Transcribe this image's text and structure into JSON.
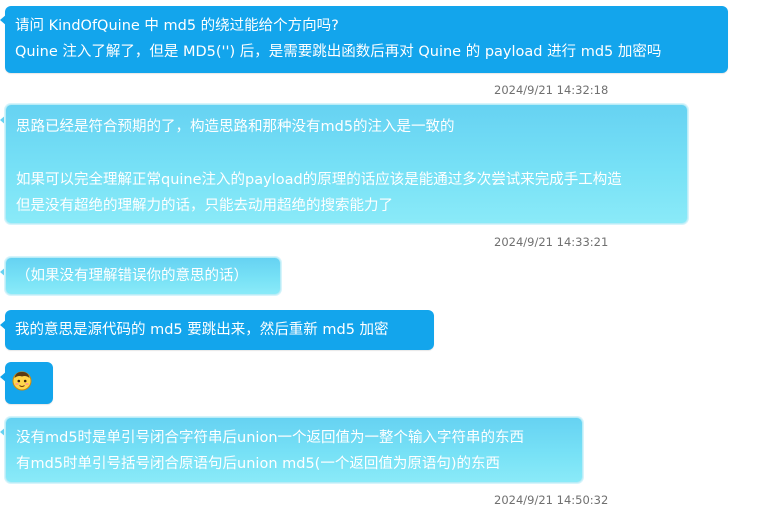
{
  "messages": [
    {
      "lines": [
        "请问 KindOfQuine 中 md5 的绕过能给个方向吗?",
        "Quine 注入了解了，但是 MD5('') 后，是需要跳出函数后再对 Quine 的 payload 进行 md5 加密吗"
      ],
      "timestamp": "2024/9/21 14:32:18"
    },
    {
      "lines": [
        "思路已经是符合预期的了，构造思路和那种没有md5的注入是一致的",
        "",
        "如果可以完全理解正常quine注入的payload的原理的话应该是能通过多次尝试来完成手工构造",
        "但是没有超绝的理解力的话，只能去动用超绝的搜索能力了"
      ],
      "timestamp": "2024/9/21 14:33:21"
    },
    {
      "lines": [
        "（如果没有理解错误你的意思的话）"
      ]
    },
    {
      "lines": [
        "我的意思是源代码的 md5 要跳出来，然后重新 md5 加密"
      ]
    },
    {
      "emoji": "face-emoji"
    },
    {
      "lines": [
        "没有md5时是单引号闭合字符串后union一个返回值为一整个输入字符串的东西",
        "有md5时单引号括号闭合原语句后union md5(一个返回值为原语句)的东西"
      ],
      "timestamp": "2024/9/21 14:50:32"
    }
  ],
  "colors": {
    "sent_bubble": "#13a5ec",
    "reply_bubble": "#77e1f6",
    "timestamp_text": "#707070"
  }
}
